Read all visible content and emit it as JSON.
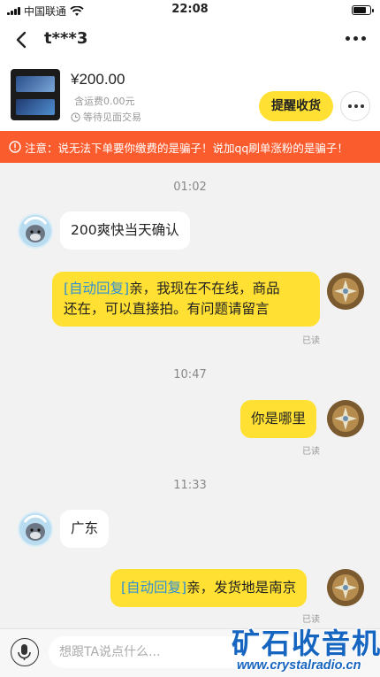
{
  "status_bar": {
    "carrier": "中国联通",
    "time": "22:08",
    "battery_level_fraction": 0.85
  },
  "nav": {
    "title": "t***3",
    "back_icon": "chevron-left-icon",
    "more_icon": "more-dots-icon"
  },
  "product": {
    "price": "¥200.00",
    "shipping": "含运费0.00元",
    "status": "等待见面交易",
    "remind_button": "提醒收货",
    "menu_icon": "more-dots-icon"
  },
  "notice": {
    "text": "注意：说无法下单要你缴费的是骗子！说加qq刷单涨粉的是骗子！",
    "icon": "warning-icon"
  },
  "messages": [
    {
      "type": "timestamp",
      "text": "01:02"
    },
    {
      "type": "incoming",
      "text": "200爽快当天确认"
    },
    {
      "type": "outgoing",
      "tag": "[自动回复]",
      "text_line1": "亲，我现在不在线，商品",
      "text_line2": "还在，可以直接拍。有问题请留言",
      "read": "已读"
    },
    {
      "type": "timestamp",
      "text": "10:47"
    },
    {
      "type": "outgoing",
      "text": "你是哪里",
      "read": "已读"
    },
    {
      "type": "timestamp",
      "text": "11:33"
    },
    {
      "type": "incoming",
      "text": "广东"
    },
    {
      "type": "outgoing",
      "tag": "[自动回复]",
      "text": "亲，发货地是南京",
      "read": "已读"
    }
  ],
  "input": {
    "placeholder": "想跟TA说点什么...",
    "value": "",
    "mic_icon": "microphone-icon"
  },
  "watermark": {
    "chinese": "矿石收音机",
    "url": "www.crystalradio.cn"
  },
  "colors": {
    "accent_yellow": "#ffe033",
    "notice_orange": "#fb5c2e",
    "auto_reply_blue": "#2f8fd6",
    "watermark_blue": "#1665c0"
  }
}
